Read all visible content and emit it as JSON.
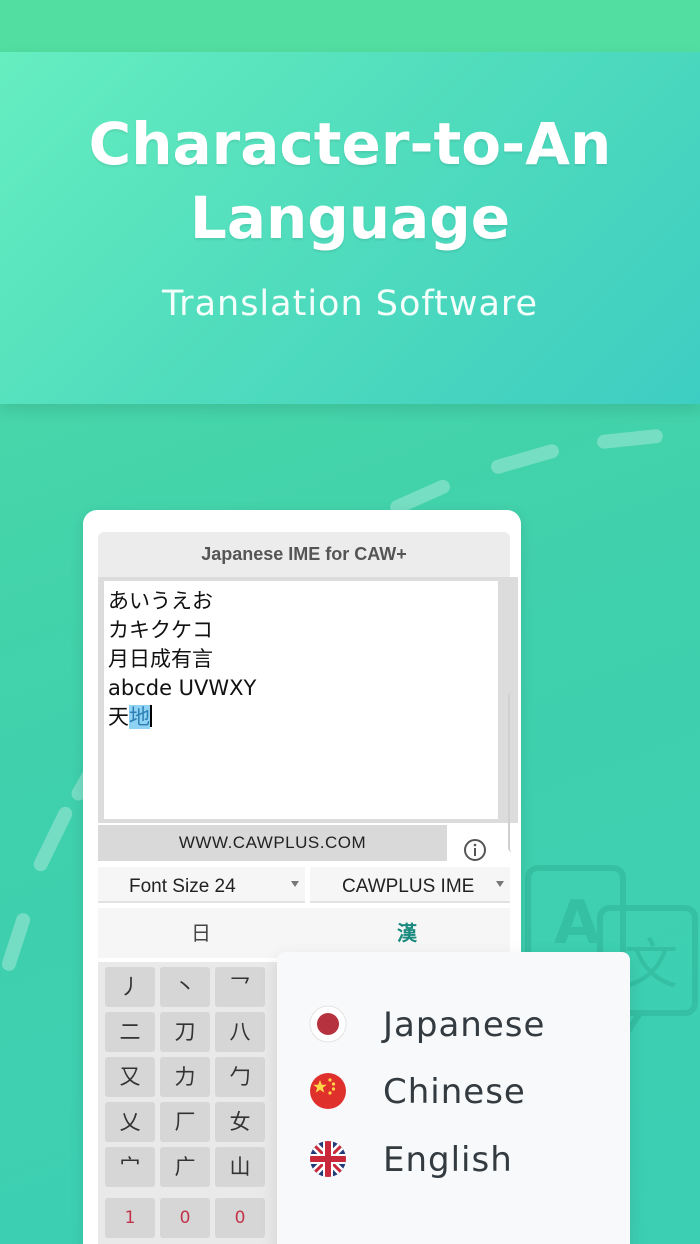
{
  "hero": {
    "title_line1": "Character-to-An",
    "title_line2": "Language",
    "subtitle": "Translation Software"
  },
  "app": {
    "title": "Japanese IME for CAW+",
    "editor_lines": [
      "あいうえお",
      "カキクケコ",
      "月日成有言",
      "abcde UVWXY"
    ],
    "editor_last_plain": "天",
    "editor_last_selected": "地",
    "url": "WWW.CAWPLUS.COM",
    "font_size_select": "Font Size 24",
    "ime_select": "CAWPLUS IME",
    "tabs": [
      {
        "label": "日",
        "active": false
      },
      {
        "label": "漢",
        "active": true
      }
    ],
    "keypad_rows": [
      [
        "丿",
        "丶",
        "乛"
      ],
      [
        "二",
        "刀",
        "八"
      ],
      [
        "又",
        "力",
        "勹"
      ],
      [
        "乂",
        "厂",
        "女"
      ],
      [
        "宀",
        "广",
        "山"
      ],
      [
        "1",
        "0",
        "0"
      ]
    ]
  },
  "languages": [
    {
      "label": "Japanese",
      "flag": "japan-flag-icon"
    },
    {
      "label": "Chinese",
      "flag": "china-flag-icon"
    },
    {
      "label": "English",
      "flag": "uk-flag-icon"
    }
  ],
  "colors": {
    "background": "#3fd0ad",
    "hero": "#4fdcbd",
    "accent_tab": "#1a8a7e",
    "number_key": "#c2334a"
  }
}
